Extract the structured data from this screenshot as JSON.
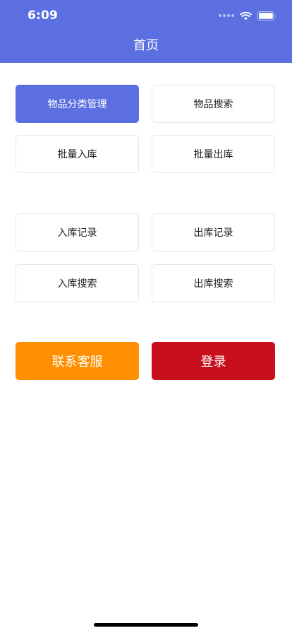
{
  "status_bar": {
    "time": "6:09"
  },
  "header": {
    "title": "首页"
  },
  "item_buttons": {
    "category_manage": "物品分类管理",
    "item_search": "物品搜索",
    "batch_inbound": "批量入库",
    "batch_outbound": "批量出库"
  },
  "record_buttons": {
    "inbound_records": "入库记录",
    "outbound_records": "出库记录",
    "inbound_search": "入库搜索",
    "outbound_search": "出库搜索"
  },
  "action_buttons": {
    "contact_service": "联系客服",
    "login": "登录"
  },
  "colors": {
    "header": "#5B6FE0",
    "primary_button": "#5B6FE0",
    "contact_button": "#FF8F00",
    "login_button": "#C80F1E"
  },
  "icons": [
    "signal-icon",
    "wifi-icon",
    "battery-icon"
  ]
}
